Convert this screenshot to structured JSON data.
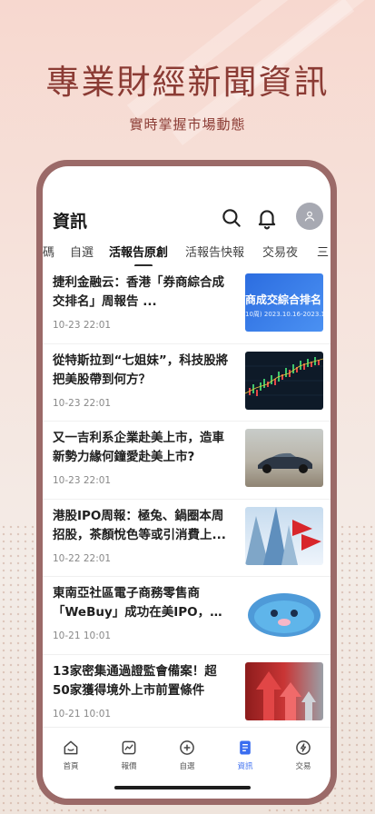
{
  "hero": {
    "title": "專業財經新聞資訊",
    "subtitle": "實時掌握市場動態"
  },
  "header": {
    "title": "資訊",
    "icons": [
      "search-icon",
      "bell-icon",
      "avatar-icon"
    ]
  },
  "tabs": {
    "items": [
      "碼",
      "自選",
      "活報告原創",
      "活報告快報",
      "交易夜"
    ],
    "active_index": 2,
    "menu_glyph": "三"
  },
  "news": [
    {
      "title": "捷利金融云：香港「券商綜合成交排名」周報告 ...",
      "time": "10-23 22:01",
      "thumb": "ranking-banner",
      "thumb_text_1": "商成交綜合排名",
      "thumb_text_2": "10周) 2023.10.16-2023.10"
    },
    {
      "title": "從特斯拉到“七姐妹”，科技股將把美股帶到何方？",
      "time": "10-23 22:01",
      "thumb": "stock-chart"
    },
    {
      "title": "又一吉利系企業赴美上市，造車新勢力緣何鐘愛赴美上市?",
      "time": "10-23 22:01",
      "thumb": "sports-car"
    },
    {
      "title": "港股IPO周報：極兔、鍋圈本周招股，茶顏悅色等或引消費上...",
      "time": "10-22 22:01",
      "thumb": "buildings-flags"
    },
    {
      "title": "東南亞社區電子商務零售商「WeBuy」成功在美IPO，首...",
      "time": "10-21 10:01",
      "thumb": "webuy-mascot"
    },
    {
      "title": "13家密集通過證監會備案！超50家獲得境外上市前置條件",
      "time": "10-21 10:01",
      "thumb": "arrows-up"
    }
  ],
  "nav": [
    {
      "label": "首頁",
      "icon": "home-icon"
    },
    {
      "label": "報價",
      "icon": "chart-icon"
    },
    {
      "label": "自選",
      "icon": "plus-circle-icon"
    },
    {
      "label": "資訊",
      "icon": "document-icon",
      "active": true
    },
    {
      "label": "交易",
      "icon": "trade-icon"
    }
  ],
  "colors": {
    "hero_text": "#8b3b34",
    "phone_frame": "#9b6a68",
    "nav_active": "#3b6ef0"
  }
}
